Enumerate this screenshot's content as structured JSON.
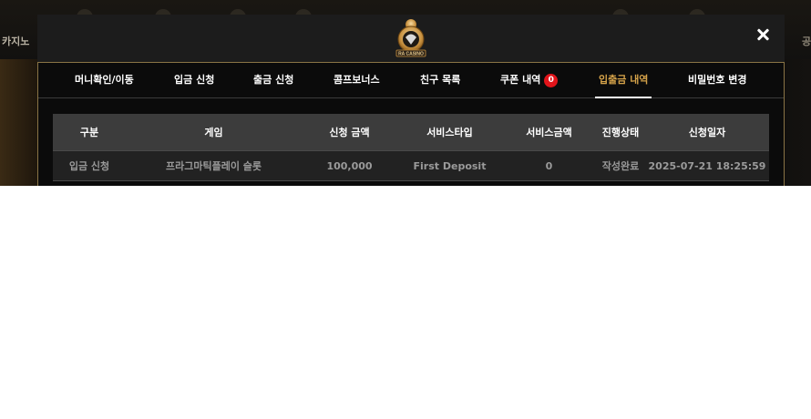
{
  "background": {
    "left_label": "카지노",
    "right_label": "공"
  },
  "modal": {
    "logo_text": "RA CASINO",
    "tabs": [
      {
        "label": "머니확인/이동",
        "active": false
      },
      {
        "label": "입금 신청",
        "active": false
      },
      {
        "label": "출금 신청",
        "active": false
      },
      {
        "label": "콤프보너스",
        "active": false
      },
      {
        "label": "친구 목록",
        "active": false
      },
      {
        "label": "쿠폰 내역",
        "badge": "0",
        "active": false
      },
      {
        "label": "입출금 내역",
        "active": true
      },
      {
        "label": "비밀번호 변경",
        "active": false
      }
    ],
    "table": {
      "headers": [
        "구분",
        "게임",
        "신청 금액",
        "서비스타입",
        "서비스금액",
        "진행상태",
        "신청일자"
      ],
      "rows": [
        [
          "입금 신청",
          "프라그마틱플레이 슬롯",
          "100,000",
          "First Deposit",
          "0",
          "작성완료",
          "2025-07-21 18:25:59"
        ]
      ]
    }
  },
  "colors": {
    "active_tab": "#d6a34a",
    "badge": "#e1141a",
    "header_bg": "#3c3c3c",
    "row_bg": "#222222",
    "border_gold": "#8a7546"
  },
  "icons": [
    "close-icon",
    "casino-logo"
  ]
}
